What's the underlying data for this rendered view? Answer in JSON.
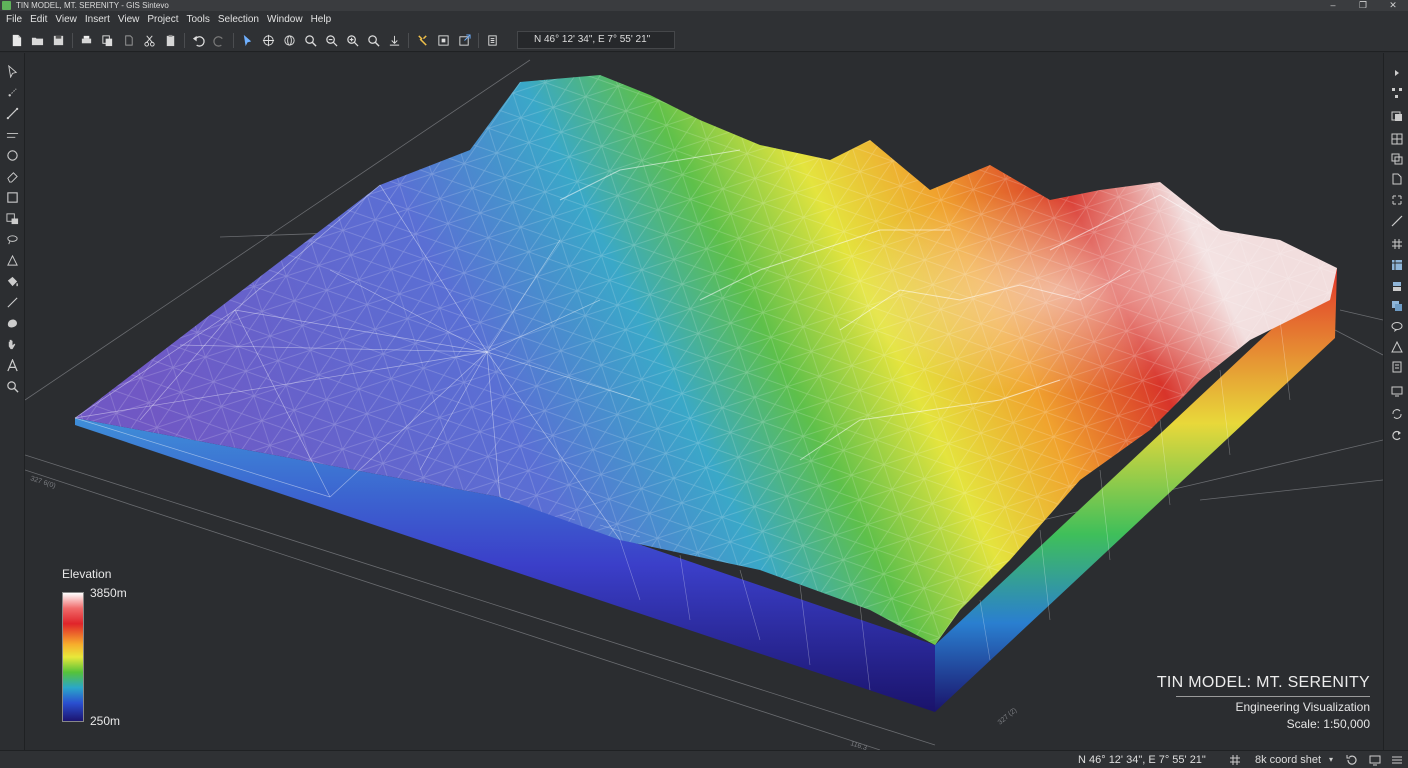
{
  "window": {
    "title": "TIN MODEL, MT. SERENITY - GIS Sintevo",
    "controls": {
      "minimize": "–",
      "maximize": "❐",
      "close": "✕"
    }
  },
  "menu": [
    "File",
    "Edit",
    "View",
    "Insert",
    "View",
    "Project",
    "Tools",
    "Selection",
    "Window",
    "Help"
  ],
  "toolbar": {
    "coordinates": "N 46° 12' 34\",  E 7° 55' 21\"",
    "icons": [
      "new-file-icon",
      "open-folder-icon",
      "save-icon",
      "print-icon",
      "copy-icon",
      "paste-doc-icon",
      "cut-icon",
      "clipboard-icon",
      "undo-icon",
      "redo-icon",
      "select-pointer-icon",
      "pan-icon",
      "globe-icon",
      "zoom-in-icon",
      "zoom-out-icon",
      "zoom-extent-icon",
      "zoom-window-icon",
      "measure-icon",
      "tools-icon",
      "layer-frame-icon",
      "export-icon",
      "properties-icon"
    ]
  },
  "left_tools": [
    "pointer-icon",
    "point-icon",
    "line-icon",
    "polyline-icon",
    "circle-icon",
    "eraser-icon",
    "rectangle-icon",
    "polygon-select-icon",
    "lasso-icon",
    "triangle-icon",
    "bucket-icon",
    "ruler-line-icon",
    "blob-icon",
    "hand-icon",
    "text-icon",
    "magnifier-icon"
  ],
  "right_tools": [
    "arrow-icon",
    "nodes-icon",
    "layers-icon",
    "tile-icon",
    "copy-icon",
    "document-icon",
    "align-icon",
    "diagonal-icon",
    "grid-icon",
    "table-icon",
    "stack-icon",
    "overlay-icon",
    "speech-icon",
    "delta-icon",
    "stamp-icon",
    "monitor-icon",
    "sync-icon",
    "redo-icon"
  ],
  "legend": {
    "title": "Elevation",
    "max_label": "3850m",
    "min_label": "250m",
    "colors": [
      "#ffffff",
      "#e0242a",
      "#f7ac2c",
      "#e8e83a",
      "#55c23a",
      "#2aa7c9",
      "#2a4fd0",
      "#1c1470"
    ]
  },
  "caption": {
    "title": "TIN MODEL: MT. SERENITY",
    "subtitle": "Engineering Visualization",
    "scale": "Scale: 1:50,000"
  },
  "status": {
    "coordinates": "N 46° 12' 34\",  E 7° 55' 21\"",
    "sheet": "8k coord shet",
    "chevron": "▾"
  }
}
